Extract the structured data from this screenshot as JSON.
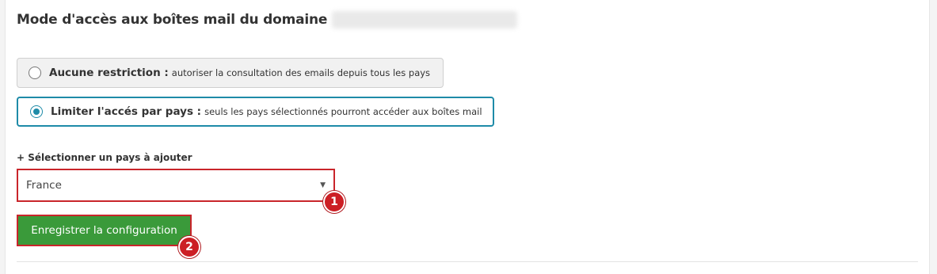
{
  "header": {
    "title": "Mode d'accès aux boîtes mail du domaine"
  },
  "access_mode": {
    "options": [
      {
        "label": "Aucune restriction :",
        "description": "autoriser la consultation des emails depuis tous les pays",
        "selected": false
      },
      {
        "label": "Limiter l'accés par pays :",
        "description": "seuls les pays sélectionnés pourront accéder aux boîtes mail",
        "selected": true
      }
    ]
  },
  "country_select": {
    "label": "+ Sélectionner un pays à ajouter",
    "value": "France",
    "caret": "▼"
  },
  "actions": {
    "save_label": "Enregistrer la configuration"
  },
  "annotations": {
    "badge_1": "1",
    "badge_2": "2"
  },
  "colors": {
    "accent": "#1e8ba8",
    "highlight_border": "#c9252b",
    "save_button": "#3a9a3a",
    "badge": "#cc1f25"
  }
}
